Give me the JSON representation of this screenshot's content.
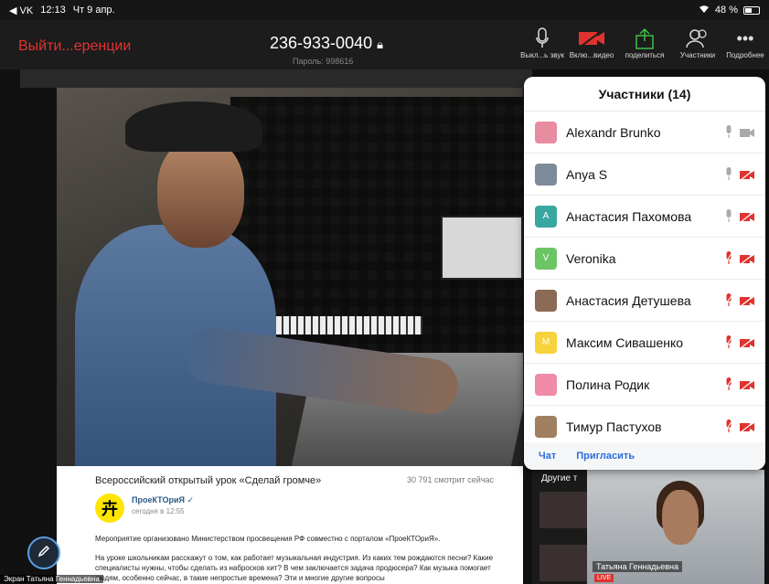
{
  "status": {
    "carrier": "◀ VK",
    "time": "12:13",
    "date": "Чт 9 апр.",
    "battery": "48 %"
  },
  "toolbar": {
    "leave_label": "Выйти...еренции",
    "meeting_id": "236-933-0040",
    "password": "Пароль: 998616",
    "tools": [
      {
        "label": "Выкл...ь звук",
        "icon": "microphone-icon"
      },
      {
        "label": "Вклю...видео",
        "icon": "camera-off-icon"
      },
      {
        "label": "поделиться",
        "icon": "share-icon"
      },
      {
        "label": "Участники",
        "icon": "participants-icon"
      },
      {
        "label": "Подробнее",
        "icon": "more-icon"
      }
    ]
  },
  "panel": {
    "title": "Участники (14)",
    "participants": [
      {
        "name": "Alexandr Brunko",
        "avatar": "",
        "color": "#e88ca0",
        "mic": "on",
        "cam": "on"
      },
      {
        "name": "Anya S",
        "avatar": "",
        "color": "#7d8a9a",
        "mic": "on",
        "cam": "off"
      },
      {
        "name": "Анастасия Пахомова",
        "avatar": "A",
        "color": "#3aa6a0",
        "mic": "on",
        "cam": "off"
      },
      {
        "name": "Veronika",
        "avatar": "V",
        "color": "#6cc565",
        "mic": "off",
        "cam": "off"
      },
      {
        "name": "Анастасия Детушева",
        "avatar": "",
        "color": "#8b6b55",
        "mic": "off",
        "cam": "off"
      },
      {
        "name": "Максим Сивашенко",
        "avatar": "M",
        "color": "#f7d23a",
        "mic": "off",
        "cam": "off"
      },
      {
        "name": "Полина Родик",
        "avatar": "",
        "color": "#f08aa6",
        "mic": "off",
        "cam": "off"
      },
      {
        "name": "Тимур Пастухов",
        "avatar": "",
        "color": "#a08060",
        "mic": "off",
        "cam": "off"
      }
    ],
    "chat_label": "Чат",
    "invite_label": "Пригласить"
  },
  "page": {
    "title": "Всероссийский открытый урок «Сделай громче»",
    "views": "30 791 смотрит сейчас",
    "channel": "ПроеКТОриЯ ✓",
    "channel_time": "сегодня в 12:55",
    "desc1": "Мероприятие организовано Министерством просвещения РФ совместно с порталом «ПроеКТОриЯ».",
    "desc2": "На уроке школьникам расскажут о том, как работает музыкальная индустрия. Из каких тем рождаются песни? Какие специалисты нужны, чтобы сделать из набросков хит? В чем заключается задача продюсера? Как музыка помогает людям, особенно сейчас, в такие непростые времена? Эти и многие другие вопросы",
    "side_label": "Другие т",
    "live": "LIVE"
  },
  "pip": {
    "name": "Татьяна Геннадьевна"
  },
  "caption": "Экран Татьяна Геннадьевна",
  "colors": {
    "accent": "#2d6cdf",
    "danger": "#e0332f",
    "share": "#3fbf4a"
  }
}
